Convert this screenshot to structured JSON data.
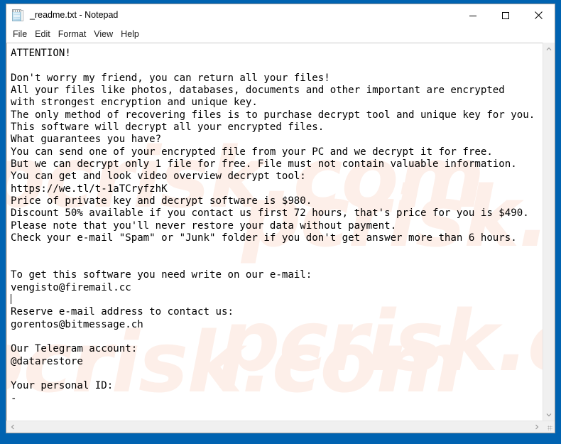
{
  "window": {
    "title": "_readme.txt - Notepad",
    "icon": "notepad-icon",
    "controls": {
      "minimize": "minimize-icon",
      "maximize": "maximize-icon",
      "close": "close-icon"
    }
  },
  "menu": {
    "items": [
      {
        "label": "File"
      },
      {
        "label": "Edit"
      },
      {
        "label": "Format"
      },
      {
        "label": "View"
      },
      {
        "label": "Help"
      }
    ]
  },
  "document": {
    "filename": "_readme.txt",
    "body": "ATTENTION!\n\nDon't worry my friend, you can return all your files!\nAll your files like photos, databases, documents and other important are encrypted\nwith strongest encryption and unique key.\nThe only method of recovering files is to purchase decrypt tool and unique key for you.\nThis software will decrypt all your encrypted files.\nWhat guarantees you have?\nYou can send one of your encrypted file from your PC and we decrypt it for free.\nBut we can decrypt only 1 file for free. File must not contain valuable information.\nYou can get and look video overview decrypt tool:\nhttps://we.tl/t-1aTCryfzhK\nPrice of private key and decrypt software is $980.\nDiscount 50% available if you contact us first 72 hours, that's price for you is $490.\nPlease note that you'll never restore your data without payment.\nCheck your e-mail \"Spam\" or \"Junk\" folder if you don't get answer more than 6 hours.\n\n\nTo get this software you need write on our e-mail:\nvengisto@firemail.cc\n",
    "body_after_caret": "\nReserve e-mail address to contact us:\ngorentos@bitmessage.ch\n\nOur Telegram account:\n@datarestore\n\nYour personal ID:\n-",
    "contacts": {
      "video_url": "https://we.tl/t-1aTCryfzhK",
      "primary_email": "vengisto@firemail.cc",
      "reserve_email": "gorentos@bitmessage.ch",
      "telegram": "@datarestore"
    },
    "prices": {
      "full": "$980",
      "discounted": "$490",
      "discount": "50%",
      "deadline_hours": "72"
    },
    "personal_id": "-"
  },
  "watermark": {
    "text": "pcrisk.com",
    "color": "#fdefe9"
  },
  "scrollbars": {
    "vertical": {
      "up": "chevron-up-icon",
      "down": "chevron-down-icon"
    },
    "horizontal": {
      "left": "chevron-left-icon",
      "right": "chevron-right-icon"
    }
  },
  "colors": {
    "desktop": "#0063B1",
    "window_bg": "#ffffff",
    "text": "#000000",
    "scrollbar": "#f0f0f0"
  }
}
